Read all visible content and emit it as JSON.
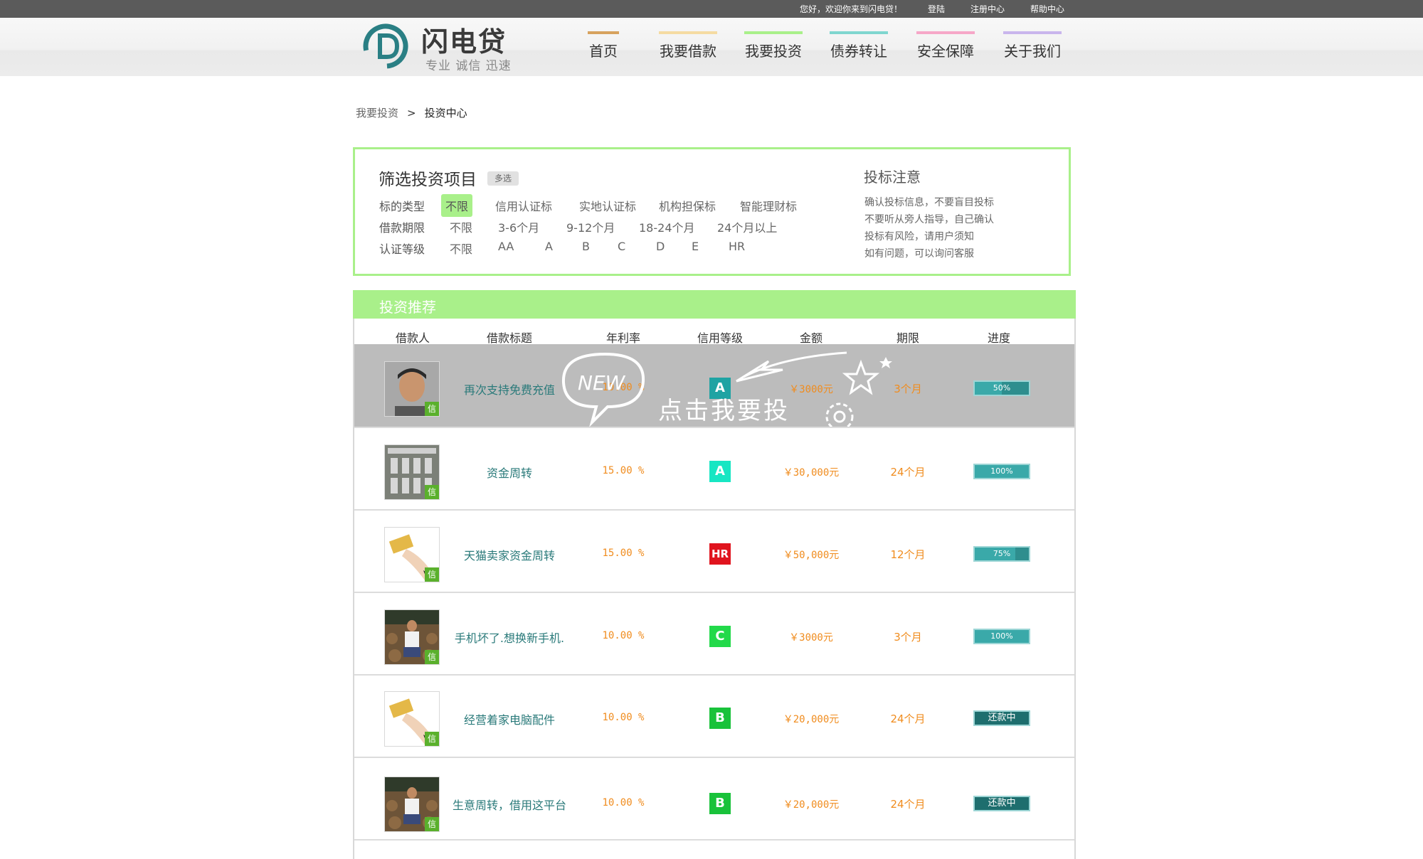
{
  "topbar": {
    "welcome": "您好，欢迎你来到闪电贷！",
    "login": "登陆",
    "register": "注册中心",
    "help": "帮助中心"
  },
  "brand": {
    "name": "闪电贷",
    "slogan": "专业 诚信 迅速"
  },
  "nav": [
    {
      "label": "首页",
      "color": "#d7a25e"
    },
    {
      "label": "我要借款",
      "color": "#f5dba2"
    },
    {
      "label": "我要投资",
      "color": "#a9f08a"
    },
    {
      "label": "债券转让",
      "color": "#7fd6cf"
    },
    {
      "label": "安全保障",
      "color": "#f6a7c8"
    },
    {
      "label": "关于我们",
      "color": "#c9b5ec"
    }
  ],
  "breadcrumb": {
    "parent": "我要投资",
    "separator": ">",
    "current": "投资中心"
  },
  "filter": {
    "title": "筛选投资项目",
    "multi": "多选",
    "groups": [
      {
        "label": "标的类型",
        "options": [
          "不限",
          "信用认证标",
          "实地认证标",
          "机构担保标",
          "智能理财标"
        ],
        "selected": "不限"
      },
      {
        "label": "借款期限",
        "options": [
          "不限",
          "3-6个月",
          "9-12个月",
          "18-24个月",
          "24个月以上"
        ]
      },
      {
        "label": "认证等级",
        "options": [
          "不限",
          "AA",
          "A",
          "B",
          "C",
          "D",
          "E",
          "HR"
        ]
      }
    ]
  },
  "notice": {
    "title": "投标注意",
    "lines": [
      "确认投标信息，不要盲目投标",
      "不要听从旁人指导，自己确认",
      "投标有风险，请用户须知",
      "如有问题，可以询问客服"
    ]
  },
  "recommend": {
    "title": "投资推荐",
    "headers": [
      "借款人",
      "借款标题",
      "年利率",
      "信用等级",
      "金额",
      "期限",
      "进度"
    ],
    "overlay": {
      "badge": "NEW",
      "cta": "点击我要投"
    },
    "credit_tag": "信",
    "rows": [
      {
        "title": "再次支持免费充值",
        "rate": "10.00 %",
        "grade": "A",
        "grade_color": "#1fa3a3",
        "amount": "￥3000元",
        "term": "3个月",
        "progress": "50%",
        "progress_value": 0.5
      },
      {
        "title": "资金周转",
        "rate": "15.00 %",
        "grade": "A",
        "grade_color": "#17e6c3",
        "amount": "￥30,000元",
        "term": "24个月",
        "progress": "100%",
        "progress_value": 1.0
      },
      {
        "title": "天猫卖家资金周转",
        "rate": "15.00 %",
        "grade": "HR",
        "grade_color": "#e0141e",
        "amount": "￥50,000元",
        "term": "12个月",
        "progress": "75%",
        "progress_value": 0.75
      },
      {
        "title": "手机坏了.想换新手机.",
        "rate": "10.00 %",
        "grade": "C",
        "grade_color": "#22d94a",
        "amount": "￥3000元",
        "term": "3个月",
        "progress": "100%",
        "progress_value": 1.0
      },
      {
        "title": "经营着家电脑配件",
        "rate": "10.00 %",
        "grade": "B",
        "grade_color": "#19c23a",
        "amount": "￥20,000元",
        "term": "24个月",
        "progress": "还款中"
      },
      {
        "title": "生意周转，借用这平台",
        "rate": "10.00 %",
        "grade": "B",
        "grade_color": "#19c23a",
        "amount": "￥20,000元",
        "term": "24个月",
        "progress": "还款中"
      }
    ]
  }
}
